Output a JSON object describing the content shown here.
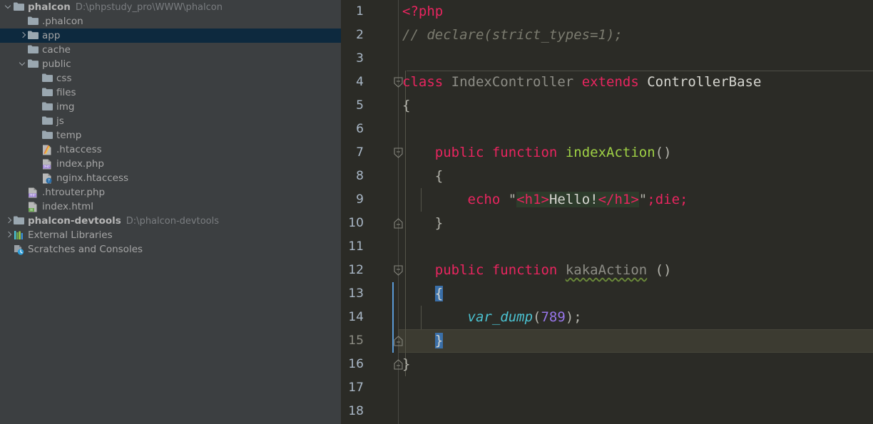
{
  "sidebar": {
    "items": [
      {
        "label": "phalcon",
        "path": "D:\\phpstudy_pro\\WWW\\phalcon",
        "icon": "folder-icon",
        "indent": 0,
        "twisty": "down",
        "bold": true,
        "selected": false
      },
      {
        "label": ".phalcon",
        "path": "",
        "icon": "folder-icon",
        "indent": 1,
        "twisty": "",
        "bold": false,
        "selected": false
      },
      {
        "label": "app",
        "path": "",
        "icon": "folder-icon",
        "indent": 1,
        "twisty": "right",
        "bold": false,
        "selected": true
      },
      {
        "label": "cache",
        "path": "",
        "icon": "folder-icon",
        "indent": 1,
        "twisty": "",
        "bold": false,
        "selected": false
      },
      {
        "label": "public",
        "path": "",
        "icon": "folder-icon",
        "indent": 1,
        "twisty": "down",
        "bold": false,
        "selected": false
      },
      {
        "label": "css",
        "path": "",
        "icon": "folder-icon",
        "indent": 2,
        "twisty": "",
        "bold": false,
        "selected": false
      },
      {
        "label": "files",
        "path": "",
        "icon": "folder-icon",
        "indent": 2,
        "twisty": "",
        "bold": false,
        "selected": false
      },
      {
        "label": "img",
        "path": "",
        "icon": "folder-icon",
        "indent": 2,
        "twisty": "",
        "bold": false,
        "selected": false
      },
      {
        "label": "js",
        "path": "",
        "icon": "folder-icon",
        "indent": 2,
        "twisty": "",
        "bold": false,
        "selected": false
      },
      {
        "label": "temp",
        "path": "",
        "icon": "folder-icon",
        "indent": 2,
        "twisty": "",
        "bold": false,
        "selected": false
      },
      {
        "label": ".htaccess",
        "path": "",
        "icon": "htaccess-file-icon",
        "indent": 2,
        "twisty": "",
        "bold": false,
        "selected": false
      },
      {
        "label": "index.php",
        "path": "",
        "icon": "php-file-icon",
        "indent": 2,
        "twisty": "",
        "bold": false,
        "selected": false
      },
      {
        "label": "nginx.htaccess",
        "path": "",
        "icon": "unknown-file-icon",
        "indent": 2,
        "twisty": "",
        "bold": false,
        "selected": false
      },
      {
        "label": ".htrouter.php",
        "path": "",
        "icon": "php-file-icon",
        "indent": 1,
        "twisty": "",
        "bold": false,
        "selected": false
      },
      {
        "label": "index.html",
        "path": "",
        "icon": "html-file-icon",
        "indent": 1,
        "twisty": "",
        "bold": false,
        "selected": false
      },
      {
        "label": "phalcon-devtools",
        "path": "D:\\phalcon-devtools",
        "icon": "folder-icon",
        "indent": 0,
        "twisty": "right",
        "bold": true,
        "selected": false
      },
      {
        "label": "External Libraries",
        "path": "",
        "icon": "libraries-icon",
        "indent": 0,
        "twisty": "right",
        "bold": false,
        "selected": false
      },
      {
        "label": "Scratches and Consoles",
        "path": "",
        "icon": "scratches-icon",
        "indent": 0,
        "twisty": "",
        "bold": false,
        "selected": false
      }
    ]
  },
  "editor": {
    "line_numbers": [
      "1",
      "2",
      "3",
      "4",
      "5",
      "6",
      "7",
      "8",
      "9",
      "10",
      "11",
      "12",
      "13",
      "14",
      "15",
      "16",
      "17",
      "18"
    ],
    "current_line": 15,
    "lines": [
      {
        "n": 1,
        "text": "<?php"
      },
      {
        "n": 2,
        "text": "// declare(strict_types=1);"
      },
      {
        "n": 3,
        "text": ""
      },
      {
        "n": 4,
        "text": "class IndexController extends ControllerBase"
      },
      {
        "n": 5,
        "text": "{"
      },
      {
        "n": 6,
        "text": ""
      },
      {
        "n": 7,
        "text": "    public function indexAction()"
      },
      {
        "n": 8,
        "text": "    {"
      },
      {
        "n": 9,
        "text": "        echo \"<h1>Hello!</h1>\";die;"
      },
      {
        "n": 10,
        "text": "    }"
      },
      {
        "n": 11,
        "text": ""
      },
      {
        "n": 12,
        "text": "    public function kakaAction ()"
      },
      {
        "n": 13,
        "text": "    {"
      },
      {
        "n": 14,
        "text": "        var_dump(789);"
      },
      {
        "n": 15,
        "text": "    }"
      },
      {
        "n": 16,
        "text": "}"
      },
      {
        "n": 17,
        "text": ""
      },
      {
        "n": 18,
        "text": ""
      }
    ],
    "tokens": {
      "php_open": "<?php",
      "comment": "// declare(strict_types=1);",
      "kw_class": "class",
      "name_index_controller": "IndexController",
      "kw_extends": "extends",
      "name_controller_base": "ControllerBase",
      "brace_open": "{",
      "brace_close": "}",
      "kw_public": "public",
      "kw_function": "function",
      "fn_index_action": "indexAction",
      "fn_kaka_action": "kakaAction",
      "paren_empty": "()",
      "paren_empty_spaced": " ()",
      "kw_echo": "echo",
      "quote": "\"",
      "tag_h1_open": "<h1>",
      "str_hello": "Hello!",
      "tag_h1_close": "</h1>",
      "semi_die": ";die;",
      "fn_var_dump": "var_dump",
      "num_789": "789",
      "call_tail": ");",
      "paren_open": "("
    }
  },
  "colors": {
    "sidebar_bg": "#3c3f41",
    "sidebar_selected_bg": "#0d293e",
    "editor_bg": "#2b2b26",
    "caret_line_bg": "#3c3b31",
    "keyword": "#e8255f",
    "comment": "#7b7b6f",
    "function_name": "#9fd145",
    "number": "#9876ea",
    "builtin_function": "#4bc2d1",
    "string_highlight": "#2d3b2b",
    "brace_match": "#3a6fa8",
    "indent_guide_active": "#5a9ad6",
    "line_number": "#a9b7c6"
  }
}
